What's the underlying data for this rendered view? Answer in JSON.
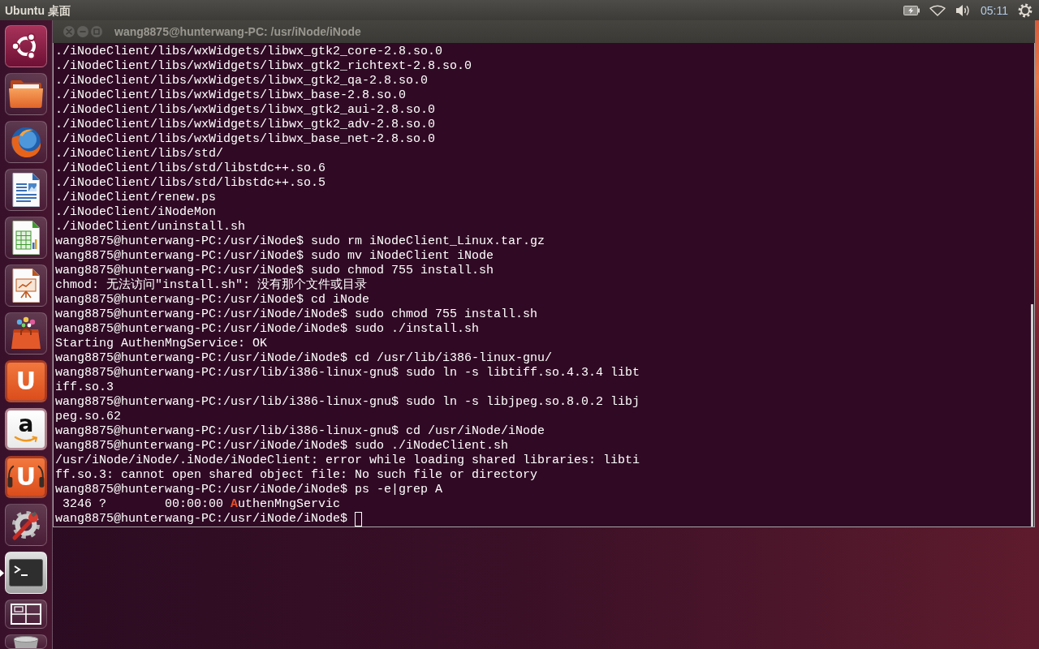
{
  "top_panel": {
    "title": "Ubuntu 桌面",
    "indicators": [
      {
        "kind": "battery"
      },
      {
        "kind": "network"
      },
      {
        "kind": "sound"
      },
      {
        "kind": "clock",
        "text": "05:11"
      },
      {
        "kind": "session"
      }
    ]
  },
  "launcher": {
    "items": [
      {
        "kind": "dash",
        "running": false
      },
      {
        "kind": "files",
        "running": false
      },
      {
        "kind": "browser",
        "running": false
      },
      {
        "kind": "writer",
        "running": false
      },
      {
        "kind": "calc",
        "running": false
      },
      {
        "kind": "impress",
        "running": false
      },
      {
        "kind": "software",
        "running": false
      },
      {
        "kind": "ubuntu_one",
        "glyph": "U",
        "running": false
      },
      {
        "kind": "amazon",
        "glyph": "a",
        "running": false
      },
      {
        "kind": "ubuntu_one_music",
        "glyph": "U",
        "running": false
      },
      {
        "kind": "settings",
        "running": false
      },
      {
        "kind": "terminal",
        "running": true
      },
      {
        "kind": "workspaces",
        "running": false
      },
      {
        "kind": "trash",
        "running": false
      }
    ]
  },
  "window": {
    "title": "wang8875@hunterwang-PC: /usr/iNode/iNode",
    "focused": false,
    "buttons": [
      {
        "kind": "close"
      },
      {
        "kind": "minimize"
      },
      {
        "kind": "maximize"
      }
    ]
  },
  "terminal": {
    "lines": [
      "./iNodeClient/libs/wxWidgets/libwx_gtk2_core-2.8.so.0",
      "./iNodeClient/libs/wxWidgets/libwx_gtk2_richtext-2.8.so.0",
      "./iNodeClient/libs/wxWidgets/libwx_gtk2_qa-2.8.so.0",
      "./iNodeClient/libs/wxWidgets/libwx_base-2.8.so.0",
      "./iNodeClient/libs/wxWidgets/libwx_gtk2_aui-2.8.so.0",
      "./iNodeClient/libs/wxWidgets/libwx_gtk2_adv-2.8.so.0",
      "./iNodeClient/libs/wxWidgets/libwx_base_net-2.8.so.0",
      "./iNodeClient/libs/std/",
      "./iNodeClient/libs/std/libstdc++.so.6",
      "./iNodeClient/libs/std/libstdc++.so.5",
      "./iNodeClient/renew.ps",
      "./iNodeClient/iNodeMon",
      "./iNodeClient/uninstall.sh",
      "wang8875@hunterwang-PC:/usr/iNode$ sudo rm iNodeClient_Linux.tar.gz",
      "wang8875@hunterwang-PC:/usr/iNode$ sudo mv iNodeClient iNode",
      "wang8875@hunterwang-PC:/usr/iNode$ sudo chmod 755 install.sh",
      "chmod: 无法访问\"install.sh\": 没有那个文件或目录",
      "wang8875@hunterwang-PC:/usr/iNode$ cd iNode",
      "wang8875@hunterwang-PC:/usr/iNode/iNode$ sudo chmod 755 install.sh",
      "wang8875@hunterwang-PC:/usr/iNode/iNode$ sudo ./install.sh",
      "Starting AuthenMngService: OK",
      "wang8875@hunterwang-PC:/usr/iNode/iNode$ cd /usr/lib/i386-linux-gnu/",
      "wang8875@hunterwang-PC:/usr/lib/i386-linux-gnu$ sudo ln -s libtiff.so.4.3.4 libt",
      "iff.so.3",
      "wang8875@hunterwang-PC:/usr/lib/i386-linux-gnu$ sudo ln -s libjpeg.so.8.0.2 libj",
      "peg.so.62",
      "wang8875@hunterwang-PC:/usr/lib/i386-linux-gnu$ cd /usr/iNode/iNode",
      "wang8875@hunterwang-PC:/usr/iNode/iNode$ sudo ./iNodeClient.sh",
      "/usr/iNode/iNode/.iNode/iNodeClient: error while loading shared libraries: libti",
      "ff.so.3: cannot open shared object file: No such file or directory",
      "wang8875@hunterwang-PC:/usr/iNode/iNode$ ps -e|grep A",
      " 3246 ?        00:00:00 **A**uthenMngServic",
      "wang8875@hunterwang-PC:/usr/iNode/iNode$"
    ]
  }
}
